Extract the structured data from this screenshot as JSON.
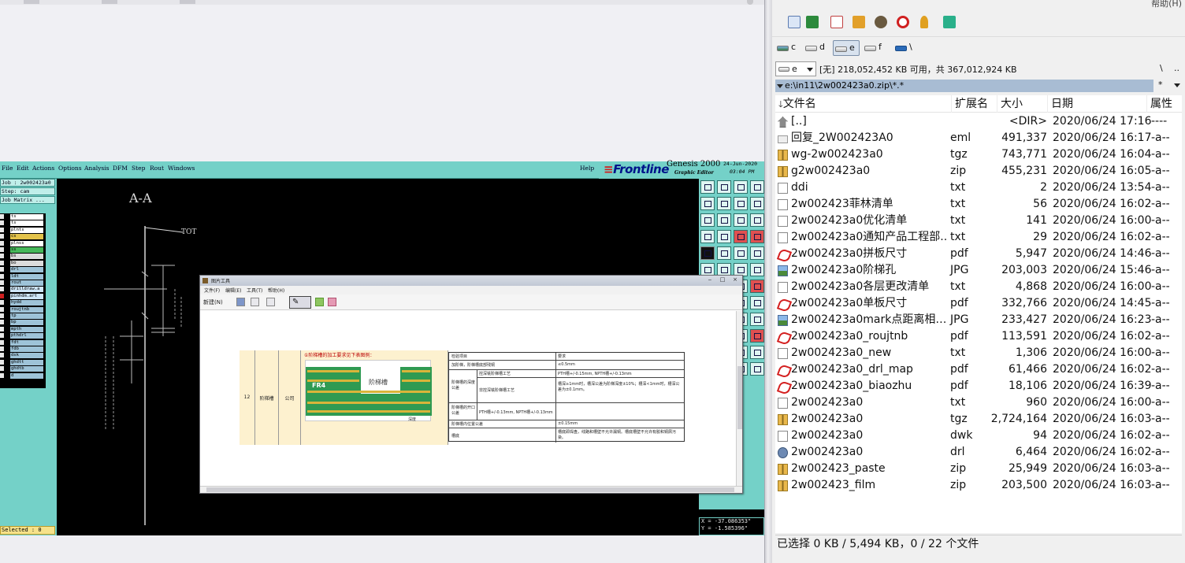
{
  "genesis": {
    "menu": [
      "File",
      "Edit",
      "Actions",
      "Options",
      "Analysis",
      "DFM",
      "Step",
      "Rout",
      "Windows"
    ],
    "help": "Help",
    "brand": "Frontline",
    "product": "Genesis 2000",
    "subtitle": "Graphic Editor",
    "date": "24-Jun-2020",
    "time": "03:04 PM",
    "job": "Job : 2w002423a0",
    "step": "Step: cam",
    "job_matrix": "Job Matrix ...",
    "layers": [
      "ts",
      "ts",
      "plnts",
      "cs",
      "plnss",
      "ss",
      "bs",
      "bo",
      "drl",
      "ldt",
      "rout",
      "drilldraw.a",
      "pinhdm.art",
      "hydd",
      "roujtnb",
      "tp",
      "bp",
      "mpth",
      "pthdrl",
      "fdt",
      "fdb",
      "dsk",
      "ghdtt",
      "ghdtb",
      "d"
    ],
    "selected": "Selected : 0",
    "coord_x": "X = -37.086353\"",
    "coord_y": "Y = -1.585396\"",
    "drawing_label_top": "A-A",
    "drawing_label_tot": "TOT"
  },
  "viewer": {
    "title": "图片工具",
    "menu": [
      "文件(F)",
      "编辑(E)",
      "工具(T)",
      "帮助(H)"
    ],
    "new_label": "新建(N)",
    "pen_glyph": "✎",
    "doc": {
      "row_no": "12",
      "row_type": "阶梯槽",
      "row_tol": "公司",
      "heading": "①阶梯槽的加工要求见下表图例：",
      "pic_label": "阶梯槽",
      "pic_fr4": "FR4",
      "pic_note": "深度",
      "col1": "检验项目",
      "col2": "要求",
      "r1a": "加阶梯，阶梯槽底部残铜",
      "r1b": "≤0.5mm",
      "r2a": "阶梯槽的深度公差",
      "r2b": "控深铣阶梯槽工艺",
      "r2c": "PTH槽+/-0.15mm, NPTH槽+/-0.13mm",
      "r3b": "非控深铣阶梯槽工艺",
      "r3c": "槽深≥1mm时，槽深公差为阶梯深度±10%；槽深<1mm时，槽深公差为±0.1mm。",
      "r4a": "阶梯槽的开口公差",
      "r4c": "PTH槽+/-0.13mm, NPTH槽+/-0.13mm",
      "r5a": "阶梯槽内位置公差",
      "r5c": "±0.15mm",
      "r6a": "槽底",
      "r6c": "槽底即焊盘，线路和槽壁不允许漏铜。槽底槽壁不允许有胶和铜屑污染。"
    }
  },
  "filemanager": {
    "menu_help": "帮助(H)",
    "drives": [
      "c",
      "d",
      "e",
      "f",
      "\\"
    ],
    "selected_drive": "e",
    "combo_drive": "e",
    "free_info": "[无] 218,052,452 KB 可用，共 367,012,924 KB",
    "nav_root": "\\",
    "nav_up": "..",
    "path": "e:\\in11\\2w002423a0.zip\\*.*",
    "filter": "*",
    "columns": {
      "name": "文件名",
      "ext": "扩展名",
      "size": "大小",
      "date": "日期",
      "attr": "属性"
    },
    "files": [
      {
        "name": "[..]",
        "ext": "",
        "size": "<DIR>",
        "date": "2020/06/24 17:16",
        "attr": "----",
        "icon": "up"
      },
      {
        "name": "回复_2W002423A0",
        "ext": "eml",
        "size": "491,337",
        "date": "2020/06/24 16:17",
        "attr": "-a--",
        "icon": "mail"
      },
      {
        "name": "wg-2w002423a0",
        "ext": "tgz",
        "size": "743,771",
        "date": "2020/06/24 16:04",
        "attr": "-a--",
        "icon": "arc"
      },
      {
        "name": "g2w002423a0",
        "ext": "zip",
        "size": "455,231",
        "date": "2020/06/24 16:05",
        "attr": "-a--",
        "icon": "arc"
      },
      {
        "name": "ddi",
        "ext": "txt",
        "size": "2",
        "date": "2020/06/24 13:54",
        "attr": "-a--",
        "icon": "txt"
      },
      {
        "name": "2w002423菲林清单",
        "ext": "txt",
        "size": "56",
        "date": "2020/06/24 16:02",
        "attr": "-a--",
        "icon": "txt"
      },
      {
        "name": "2w002423a0优化清单",
        "ext": "txt",
        "size": "141",
        "date": "2020/06/24 16:00",
        "attr": "-a--",
        "icon": "txt"
      },
      {
        "name": "2w002423a0通知产品工程部..",
        "ext": "txt",
        "size": "29",
        "date": "2020/06/24 16:02",
        "attr": "-a--",
        "icon": "txt"
      },
      {
        "name": "2w002423a0拼板尺寸",
        "ext": "pdf",
        "size": "5,947",
        "date": "2020/06/24 14:46",
        "attr": "-a--",
        "icon": "pdf"
      },
      {
        "name": "2w002423a0阶梯孔",
        "ext": "JPG",
        "size": "203,003",
        "date": "2020/06/24 15:46",
        "attr": "-a--",
        "icon": "jpg"
      },
      {
        "name": "2w002423a0各层更改清单",
        "ext": "txt",
        "size": "4,868",
        "date": "2020/06/24 16:00",
        "attr": "-a--",
        "icon": "txt"
      },
      {
        "name": "2w002423a0单板尺寸",
        "ext": "pdf",
        "size": "332,766",
        "date": "2020/06/24 14:45",
        "attr": "-a--",
        "icon": "pdf"
      },
      {
        "name": "2w002423a0mark点距离相对..",
        "ext": "JPG",
        "size": "233,427",
        "date": "2020/06/24 16:23",
        "attr": "-a--",
        "icon": "jpg"
      },
      {
        "name": "2w002423a0_roujtnb",
        "ext": "pdf",
        "size": "113,591",
        "date": "2020/06/24 16:02",
        "attr": "-a--",
        "icon": "pdf"
      },
      {
        "name": "2w002423a0_new",
        "ext": "txt",
        "size": "1,306",
        "date": "2020/06/24 16:00",
        "attr": "-a--",
        "icon": "txt"
      },
      {
        "name": "2w002423a0_drl_map",
        "ext": "pdf",
        "size": "61,466",
        "date": "2020/06/24 16:02",
        "attr": "-a--",
        "icon": "pdf"
      },
      {
        "name": "2w002423a0_biaozhu",
        "ext": "pdf",
        "size": "18,106",
        "date": "2020/06/24 16:39",
        "attr": "-a--",
        "icon": "pdf"
      },
      {
        "name": "2w002423a0",
        "ext": "txt",
        "size": "960",
        "date": "2020/06/24 16:00",
        "attr": "-a--",
        "icon": "txt"
      },
      {
        "name": "2w002423a0",
        "ext": "tgz",
        "size": "2,724,164",
        "date": "2020/06/24 16:03",
        "attr": "-a--",
        "icon": "arc"
      },
      {
        "name": "2w002423a0",
        "ext": "dwk",
        "size": "94",
        "date": "2020/06/24 16:02",
        "attr": "-a--",
        "icon": "txt"
      },
      {
        "name": "2w002423a0",
        "ext": "drl",
        "size": "6,464",
        "date": "2020/06/24 16:02",
        "attr": "-a--",
        "icon": "drl"
      },
      {
        "name": "2w002423_paste",
        "ext": "zip",
        "size": "25,949",
        "date": "2020/06/24 16:03",
        "attr": "-a--",
        "icon": "arc"
      },
      {
        "name": "2w002423_film",
        "ext": "zip",
        "size": "203,500",
        "date": "2020/06/24 16:03",
        "attr": "-a--",
        "icon": "arc"
      }
    ],
    "status": "已选择 0 KB / 5,494 KB，0 / 22 个文件"
  },
  "colors": {
    "genesis_cyan": "#74d1c8",
    "path_blue": "#a8bcd3",
    "pdf_red": "#d42020"
  }
}
